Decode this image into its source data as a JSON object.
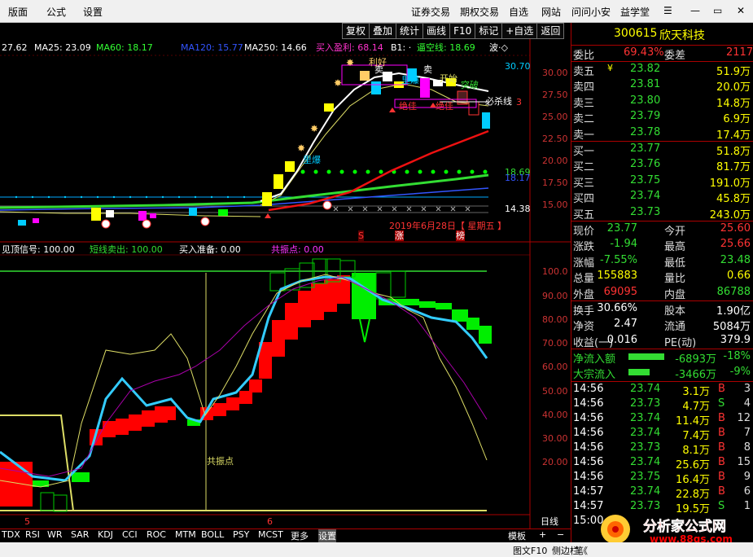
{
  "menu": {
    "items": [
      "版面",
      "公式",
      "设置"
    ],
    "right": [
      "证券交易",
      "期权交易",
      "自选",
      "网站",
      "问问小安",
      "益学堂"
    ]
  },
  "window_controls": {
    "menu_icon": "☰",
    "minimize": "—",
    "maximize": "▭",
    "close": "✕"
  },
  "toolbar": [
    "复权",
    "叠加",
    "统计",
    "画线",
    "F10",
    "标记",
    "+自选",
    "返回"
  ],
  "main_legend": {
    "ma_a": "27.62",
    "ma25": "MA25: 23.09",
    "ma60": "MA60: 18.17",
    "ma120": "MA120: 15.77",
    "ma250": "MA250: 14.66",
    "buy_profit": "买入盈利: 68.14",
    "b1": "B1: ·",
    "tong": "逼空线: 18.69",
    "wave": "波·◇"
  },
  "main_axis": [
    "30.00",
    "27.50",
    "25.00",
    "22.50",
    "20.00",
    "17.50",
    "15.00"
  ],
  "main_axis_tags": {
    "t1": "30.70",
    "t2": "3",
    "t3": "18.69",
    "t4": "18.17",
    "t5": "14.38"
  },
  "annotations": {
    "mai": "卖",
    "mai2": "卖",
    "lihao": "利好",
    "bibao": "里爆",
    "bibao2": "里爆",
    "juejia": "绝佳",
    "juejia2": "绝佳",
    "bishaxian": "必杀线",
    "tuwei": "突破",
    "kaichuan": "开始",
    "date": "2019年6月28日【 星期五 】",
    "s_left": "S",
    "zhang": "涨",
    "bang": "榜"
  },
  "sub_legend": {
    "jianding": "见顶信号: 100.00",
    "duanxian": "短线卖出: 100.00",
    "mairu": "买入准备: 0.00",
    "gongzhen": "共振点: 0.00"
  },
  "sub_axis": [
    "100.0",
    "90.00",
    "80.00",
    "70.00",
    "60.00",
    "50.00",
    "40.00",
    "30.00",
    "20.00"
  ],
  "sub_label": "共振点",
  "x_axis": {
    "m5": "5",
    "m6": "6",
    "day": "日线"
  },
  "bottom_tabs": [
    "TDX",
    "RSI",
    "WR",
    "SAR",
    "KDJ",
    "CCI",
    "ROC",
    "MTM",
    "BOLL",
    "PSY",
    "MCST",
    "更多",
    "设置"
  ],
  "bottom_right": {
    "moban": "模板",
    "plus": "+",
    "minus": "−"
  },
  "stock": {
    "code": "300615",
    "name": "欣天科技"
  },
  "weibi": {
    "l1": "委比",
    "v1": "69.43%",
    "l2": "委差",
    "v2": "2117"
  },
  "asks": [
    {
      "label": "卖五",
      "flag": "¥",
      "price": "23.82",
      "vol": "51.9万"
    },
    {
      "label": "卖四",
      "flag": "",
      "price": "23.81",
      "vol": "20.0万"
    },
    {
      "label": "卖三",
      "flag": "",
      "price": "23.80",
      "vol": "14.8万"
    },
    {
      "label": "卖二",
      "flag": "",
      "price": "23.79",
      "vol": "6.9万"
    },
    {
      "label": "卖一",
      "flag": "",
      "price": "23.78",
      "vol": "17.4万"
    }
  ],
  "bids": [
    {
      "label": "买一",
      "price": "23.77",
      "vol": "51.8万"
    },
    {
      "label": "买二",
      "price": "23.76",
      "vol": "81.7万"
    },
    {
      "label": "买三",
      "price": "23.75",
      "vol": "191.0万"
    },
    {
      "label": "买四",
      "price": "23.74",
      "vol": "45.8万"
    },
    {
      "label": "买五",
      "price": "23.73",
      "vol": "243.0万"
    }
  ],
  "quote": [
    {
      "l1": "现价",
      "v1": "23.77",
      "l2": "今开",
      "v2": "25.60"
    },
    {
      "l1": "涨跌",
      "v1": "-1.94",
      "l2": "最高",
      "v2": "25.66"
    },
    {
      "l1": "涨幅",
      "v1": "-7.55%",
      "l2": "最低",
      "v2": "23.48"
    },
    {
      "l1": "总量",
      "v1": "155883",
      "l2": "量比",
      "v2": "0.66"
    },
    {
      "l1": "外盘",
      "v1": "69095",
      "l2": "内盘",
      "v2": "86788"
    }
  ],
  "finance": [
    {
      "l1": "换手",
      "v1": "30.66%",
      "l2": "股本",
      "v2": "1.90亿"
    },
    {
      "l1": "净资",
      "v1": "2.47",
      "l2": "流通",
      "v2": "5084万"
    },
    {
      "l1": "收益(一)",
      "v1": "0.016",
      "l2": "PE(动)",
      "v2": "379.9"
    }
  ],
  "flows": [
    {
      "label": "净流入额",
      "value": "-6893万",
      "pct": "-18%"
    },
    {
      "label": "大宗流入",
      "value": "-3466万",
      "pct": "-9%"
    }
  ],
  "ticks": [
    {
      "t": "14:56",
      "p": "23.74",
      "v": "3.1万",
      "s": "B",
      "n": "3"
    },
    {
      "t": "14:56",
      "p": "23.73",
      "v": "4.7万",
      "s": "S",
      "n": "4"
    },
    {
      "t": "14:56",
      "p": "23.74",
      "v": "11.4万",
      "s": "B",
      "n": "12"
    },
    {
      "t": "14:56",
      "p": "23.74",
      "v": "7.4万",
      "s": "B",
      "n": "7"
    },
    {
      "t": "14:56",
      "p": "23.73",
      "v": "8.1万",
      "s": "B",
      "n": "8"
    },
    {
      "t": "14:56",
      "p": "23.74",
      "v": "25.6万",
      "s": "B",
      "n": "15"
    },
    {
      "t": "14:56",
      "p": "23.75",
      "v": "16.4万",
      "s": "B",
      "n": "9"
    },
    {
      "t": "14:57",
      "p": "23.74",
      "v": "22.8万",
      "s": "B",
      "n": "6"
    },
    {
      "t": "14:57",
      "p": "23.73",
      "v": "19.5万",
      "s": "S",
      "n": "1"
    },
    {
      "t": "15:00",
      "p": "",
      "v": "",
      "s": "",
      "n": ""
    }
  ],
  "watermark": {
    "title": "分析家公式网",
    "url": "www.88gs.com"
  },
  "status": {
    "tuwen": "图文F10",
    "cebian": "侧边栏《",
    "bi": "笔"
  }
}
